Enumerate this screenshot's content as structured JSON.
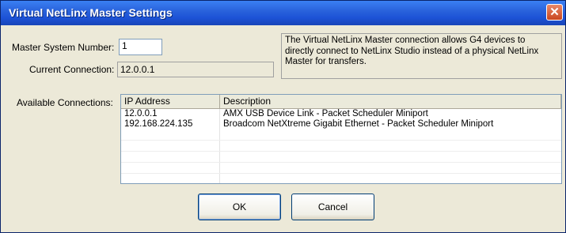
{
  "window": {
    "title": "Virtual NetLinx Master Settings",
    "close_glyph": "✕"
  },
  "form": {
    "master_system_number_label": "Master System Number:",
    "master_system_number_value": "1",
    "current_connection_label": "Current Connection:",
    "current_connection_value": "12.0.0.1",
    "info_text": "The Virtual NetLinx Master connection allows G4 devices to\ndirectly connect to NetLinx Studio instead of a physical NetLinx\nMaster for transfers.",
    "available_connections_label": "Available Connections:"
  },
  "connections": {
    "columns": [
      "IP Address",
      "Description"
    ],
    "rows": [
      {
        "ip": "12.0.0.1",
        "description": "AMX USB Device Link - Packet Scheduler Miniport"
      },
      {
        "ip": "192.168.224.135",
        "description": "Broadcom NetXtreme Gigabit Ethernet - Packet Scheduler Miniport"
      }
    ]
  },
  "buttons": {
    "ok": "OK",
    "cancel": "Cancel"
  }
}
